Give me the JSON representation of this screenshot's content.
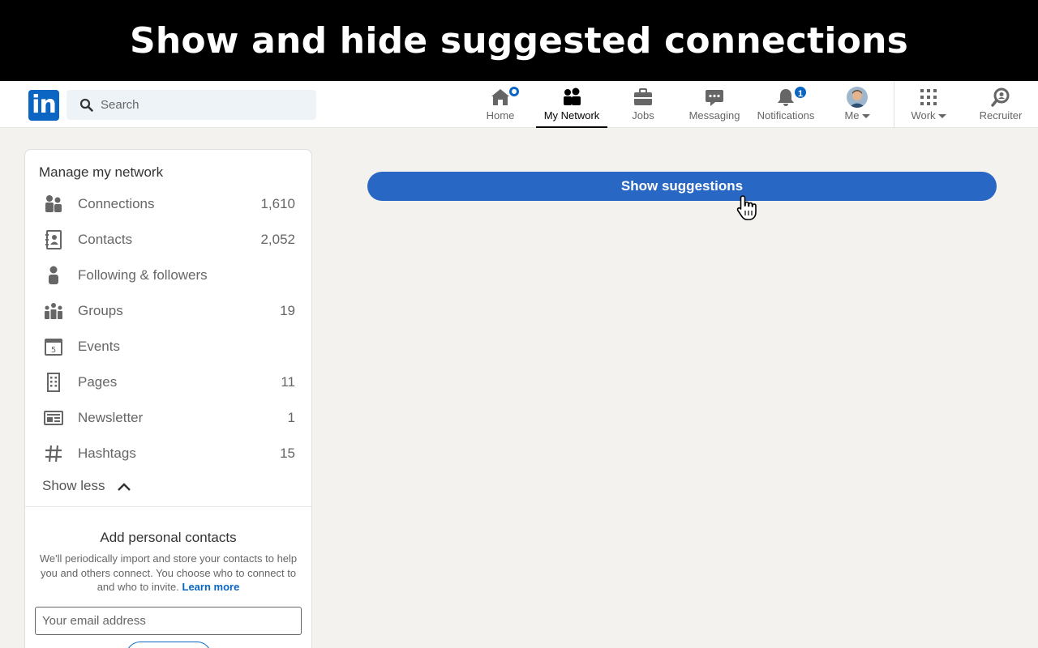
{
  "banner": {
    "title": "Show and hide suggested connections"
  },
  "header": {
    "logo_text": "in",
    "search": {
      "placeholder": "Search"
    },
    "nav": [
      {
        "label": "Home",
        "icon": "home-icon",
        "badge": "dot"
      },
      {
        "label": "My Network",
        "icon": "network-icon",
        "active": true
      },
      {
        "label": "Jobs",
        "icon": "briefcase-icon"
      },
      {
        "label": "Messaging",
        "icon": "messaging-icon"
      },
      {
        "label": "Notifications",
        "icon": "bell-icon",
        "badge": "1"
      },
      {
        "label": "Me",
        "icon": "avatar",
        "dropdown": true
      },
      {
        "label": "Work",
        "icon": "grid-icon",
        "dropdown": true
      },
      {
        "label": "Recruiter",
        "icon": "recruiter-icon"
      }
    ]
  },
  "sidebar": {
    "heading": "Manage my network",
    "items": [
      {
        "label": "Connections",
        "count": "1,610",
        "icon": "connections-icon"
      },
      {
        "label": "Contacts",
        "count": "2,052",
        "icon": "contacts-icon"
      },
      {
        "label": "Following & followers",
        "count": "",
        "icon": "person-icon"
      },
      {
        "label": "Groups",
        "count": "19",
        "icon": "groups-icon"
      },
      {
        "label": "Events",
        "count": "",
        "icon": "calendar-icon",
        "icon_text": "5"
      },
      {
        "label": "Pages",
        "count": "11",
        "icon": "building-icon"
      },
      {
        "label": "Newsletter",
        "count": "1",
        "icon": "newsletter-icon"
      },
      {
        "label": "Hashtags",
        "count": "15",
        "icon": "hashtag-icon"
      }
    ],
    "show_less": "Show less",
    "add_contacts": {
      "title": "Add personal contacts",
      "description": "We'll periodically import and store your contacts to help you and others connect. You choose who to connect to and who to invite.",
      "learn_more": "Learn more",
      "email_placeholder": "Your email address"
    }
  },
  "main": {
    "show_suggestions_label": "Show suggestions"
  },
  "colors": {
    "brand": "#0a66c2",
    "button": "#2967c4",
    "page_bg": "#f3f2ef"
  }
}
